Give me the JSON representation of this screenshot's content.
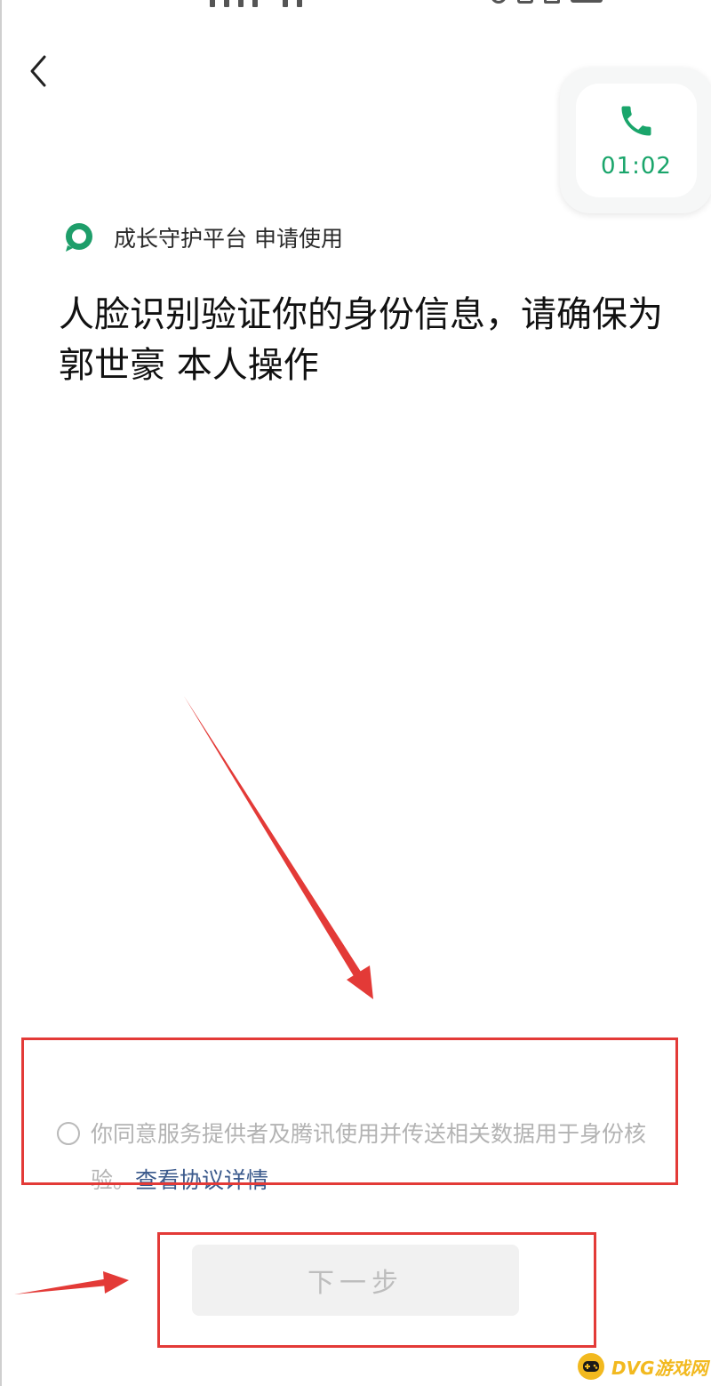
{
  "call_widget": {
    "timer": "01:02"
  },
  "app_request": {
    "text": "成长守护平台 申请使用"
  },
  "verification": {
    "title": "人脸识别验证你的身份信息，请确保为 郭世豪 本人操作"
  },
  "consent": {
    "text": "你同意服务提供者及腾讯使用并传送相关数据用于身份核验。",
    "link": "查看协议详情",
    "checked": false
  },
  "next_button": {
    "label": "下一步"
  },
  "watermark": {
    "text": "DVG游戏网"
  },
  "colors": {
    "accent": "#1aa56b",
    "link": "#3b5a8c",
    "annotation": "#e33a37",
    "disabled": "#f1f1f1"
  }
}
